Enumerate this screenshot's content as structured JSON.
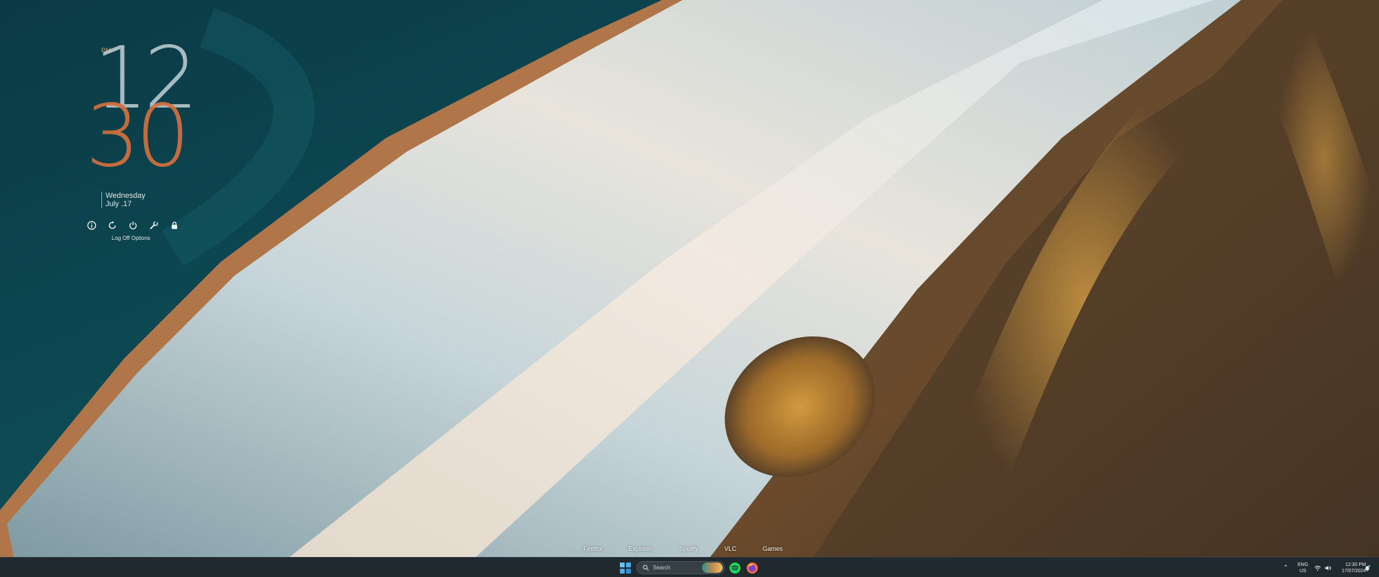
{
  "clock": {
    "ampm": "PM",
    "hours": "12",
    "minutes": "30",
    "day": "Wednesday",
    "date": "July .17"
  },
  "power_menu": {
    "label": "Log Off Options",
    "buttons": [
      {
        "icon": "info-icon"
      },
      {
        "icon": "restart-icon"
      },
      {
        "icon": "power-icon"
      },
      {
        "icon": "wrench-icon"
      },
      {
        "icon": "lock-icon"
      }
    ]
  },
  "dock": {
    "items": [
      "Firefox",
      "Explorer",
      "Spotify",
      "VLC",
      "Games"
    ]
  },
  "taskbar": {
    "search_placeholder": "Search",
    "apps": [
      {
        "name": "Spotify",
        "icon": "spotify-icon",
        "color": "#1ed760"
      },
      {
        "name": "Firefox",
        "icon": "firefox-icon",
        "color": "#ff7139"
      }
    ],
    "tray": {
      "lang_top": "ENG",
      "lang_bottom": "US",
      "time": "12:30 PM",
      "date": "17/07/2024"
    }
  },
  "colors": {
    "clock_hours": "#bdccd0",
    "clock_minutes": "#d4703e",
    "ampm": "#d9a05a",
    "taskbar_bg": "#202a2e"
  }
}
